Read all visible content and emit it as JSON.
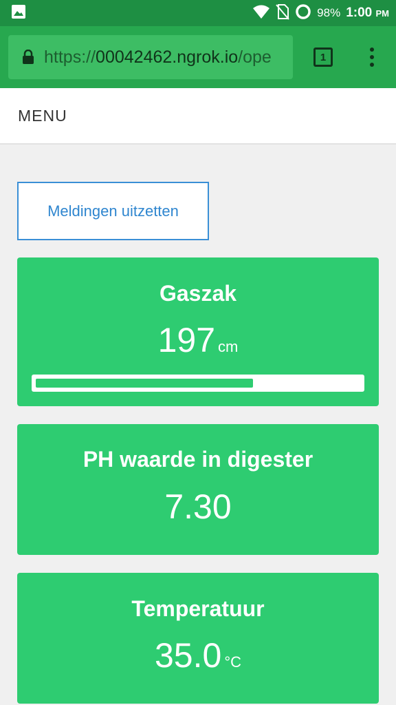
{
  "status_bar": {
    "battery": "98%",
    "time": "1:00",
    "ampm": "PM"
  },
  "browser": {
    "url_scheme": "https://",
    "url_host": "00042462.ngrok.io",
    "url_path": "/ope",
    "tab_count": "1"
  },
  "header": {
    "menu_label": "MENU"
  },
  "notifications_button": "Meldingen uitzetten",
  "cards": [
    {
      "title": "Gaszak",
      "value": "197",
      "unit": "cm",
      "progress": 0.67
    },
    {
      "title": "PH waarde in digester",
      "value": "7.30",
      "unit": ""
    },
    {
      "title": "Temperatuur",
      "value": "35.0",
      "unit": "°C"
    }
  ],
  "colors": {
    "status_bar": "#1e8f43",
    "toolbar": "#27a84f",
    "card": "#2ecc71",
    "button_border": "#3a8fd6"
  }
}
